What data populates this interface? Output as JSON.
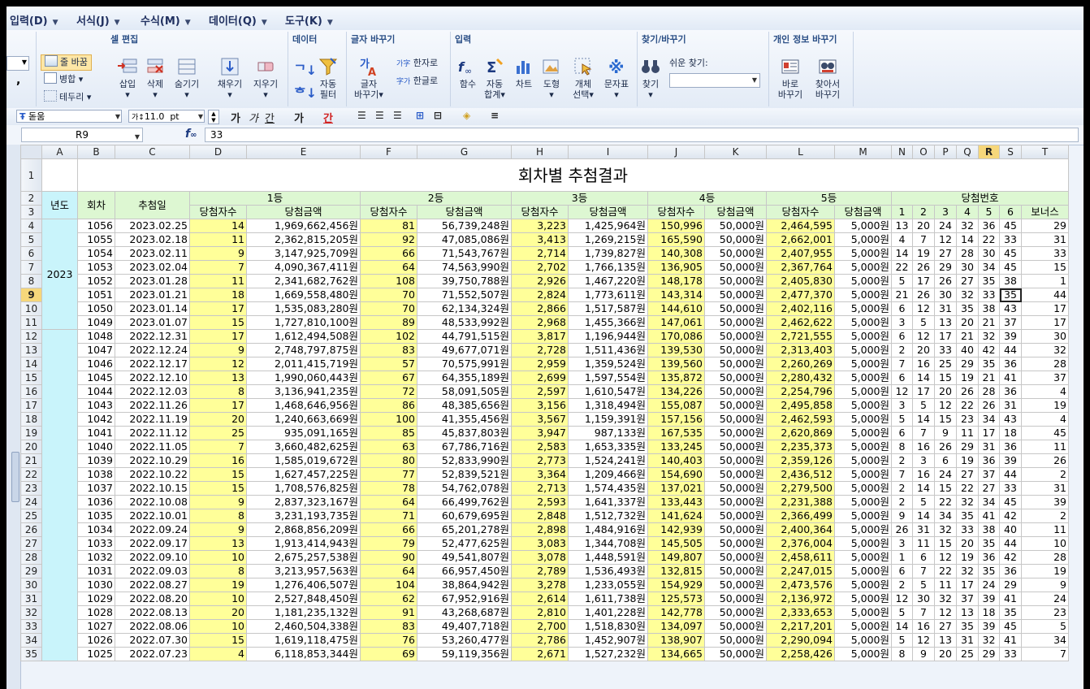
{
  "menu": [
    {
      "label": "입력(D)"
    },
    {
      "label": "서식(J)"
    },
    {
      "label": "수식(M)"
    },
    {
      "label": "데이터(Q)"
    },
    {
      "label": "도구(K)"
    }
  ],
  "ribbon": {
    "edit_title": "셀 편집",
    "wrap": "줄 바꿈",
    "merge": "병합",
    "border": "테두리",
    "insert": "삽입",
    "delete": "삭제",
    "hide": "숨기기",
    "fill": "채우기",
    "clear": "지우기",
    "data_title": "데이터",
    "auto_filter_1": "자동",
    "auto_filter_2": "필터",
    "conv_title": "글자 바꾸기",
    "conv_1": "글자",
    "conv_2": "바꾸기",
    "hanja": "한자로",
    "hangul": "한글로",
    "input_title": "입력",
    "func": "함수",
    "autosum_1": "자동",
    "autosum_2": "합계",
    "chart": "차트",
    "shape": "도형",
    "obj_1": "개체",
    "obj_2": "선택",
    "symbol": "문자표",
    "find_title": "찾기/바꾸기",
    "find": "찾기",
    "easy_find": "쉬운 찾기:",
    "privacy_title": "개인 정보 바꾸기",
    "priv1_1": "바로",
    "priv1_2": "바꾸기",
    "priv2_1": "찾아서",
    "priv2_2": "바꾸기"
  },
  "format": {
    "font": "돋움",
    "size": "11.0",
    "unit": "pt"
  },
  "formula": {
    "cell": "R9",
    "value": "33"
  },
  "columns": [
    "A",
    "B",
    "C",
    "D",
    "E",
    "F",
    "G",
    "H",
    "I",
    "J",
    "K",
    "L",
    "M",
    "N",
    "O",
    "P",
    "Q",
    "R",
    "S",
    "T"
  ],
  "selected_col": "R",
  "selected_row": "9",
  "sheet": {
    "title": "회차별 추첨결과",
    "h_year": "년도",
    "h_round": "회차",
    "h_date": "추첨일",
    "h_rank1": "1등",
    "h_rank2": "2등",
    "h_rank3": "3등",
    "h_rank4": "4등",
    "h_rank5": "5등",
    "h_nums": "당첨번호",
    "h_winners": "당첨자수",
    "h_amount": "당첨금액",
    "h_n1": "1",
    "h_n2": "2",
    "h_n3": "3",
    "h_n4": "4",
    "h_n5": "5",
    "h_n6": "6",
    "h_bonus": "보너스",
    "year_2023": "2023",
    "rows": [
      [
        "1056",
        "2023.02.25",
        "14",
        "1,969,662,456원",
        "81",
        "56,739,248원",
        "3,223",
        "1,425,964원",
        "150,996",
        "50,000원",
        "2,464,595",
        "5,000원",
        "13",
        "20",
        "24",
        "32",
        "36",
        "45",
        "29"
      ],
      [
        "1055",
        "2023.02.18",
        "11",
        "2,362,815,205원",
        "92",
        "47,085,086원",
        "3,413",
        "1,269,215원",
        "165,590",
        "50,000원",
        "2,662,001",
        "5,000원",
        "4",
        "7",
        "12",
        "14",
        "22",
        "33",
        "31"
      ],
      [
        "1054",
        "2023.02.11",
        "9",
        "3,147,925,709원",
        "66",
        "71,543,767원",
        "2,714",
        "1,739,827원",
        "140,308",
        "50,000원",
        "2,407,955",
        "5,000원",
        "14",
        "19",
        "27",
        "28",
        "30",
        "45",
        "33"
      ],
      [
        "1053",
        "2023.02.04",
        "7",
        "4,090,367,411원",
        "64",
        "74,563,990원",
        "2,702",
        "1,766,135원",
        "136,905",
        "50,000원",
        "2,367,764",
        "5,000원",
        "22",
        "26",
        "29",
        "30",
        "34",
        "45",
        "15"
      ],
      [
        "1052",
        "2023.01.28",
        "11",
        "2,341,682,762원",
        "108",
        "39,750,788원",
        "2,926",
        "1,467,220원",
        "148,178",
        "50,000원",
        "2,405,830",
        "5,000원",
        "5",
        "17",
        "26",
        "27",
        "35",
        "38",
        "1"
      ],
      [
        "1051",
        "2023.01.21",
        "18",
        "1,669,558,480원",
        "70",
        "71,552,507원",
        "2,824",
        "1,773,611원",
        "143,314",
        "50,000원",
        "2,477,370",
        "5,000원",
        "21",
        "26",
        "30",
        "32",
        "33",
        "35",
        "44"
      ],
      [
        "1050",
        "2023.01.14",
        "17",
        "1,535,083,280원",
        "70",
        "62,134,324원",
        "2,866",
        "1,517,587원",
        "144,610",
        "50,000원",
        "2,402,116",
        "5,000원",
        "6",
        "12",
        "31",
        "35",
        "38",
        "43",
        "17"
      ],
      [
        "1049",
        "2023.01.07",
        "15",
        "1,727,810,100원",
        "89",
        "48,533,992원",
        "2,968",
        "1,455,366원",
        "147,061",
        "50,000원",
        "2,462,622",
        "5,000원",
        "3",
        "5",
        "13",
        "20",
        "21",
        "37",
        "17"
      ],
      [
        "1048",
        "2022.12.31",
        "17",
        "1,612,494,508원",
        "102",
        "44,791,515원",
        "3,817",
        "1,196,944원",
        "170,086",
        "50,000원",
        "2,721,555",
        "5,000원",
        "6",
        "12",
        "17",
        "21",
        "32",
        "39",
        "30"
      ],
      [
        "1047",
        "2022.12.24",
        "9",
        "2,748,797,875원",
        "83",
        "49,677,071원",
        "2,728",
        "1,511,436원",
        "139,530",
        "50,000원",
        "2,313,403",
        "5,000원",
        "2",
        "20",
        "33",
        "40",
        "42",
        "44",
        "32"
      ],
      [
        "1046",
        "2022.12.17",
        "12",
        "2,011,415,719원",
        "57",
        "70,575,991원",
        "2,959",
        "1,359,524원",
        "139,560",
        "50,000원",
        "2,260,269",
        "5,000원",
        "7",
        "16",
        "25",
        "29",
        "35",
        "36",
        "28"
      ],
      [
        "1045",
        "2022.12.10",
        "13",
        "1,990,060,443원",
        "67",
        "64,355,189원",
        "2,699",
        "1,597,554원",
        "135,872",
        "50,000원",
        "2,280,432",
        "5,000원",
        "6",
        "14",
        "15",
        "19",
        "21",
        "41",
        "37"
      ],
      [
        "1044",
        "2022.12.03",
        "8",
        "3,136,941,235원",
        "72",
        "58,091,505원",
        "2,597",
        "1,610,547원",
        "134,226",
        "50,000원",
        "2,254,796",
        "5,000원",
        "12",
        "17",
        "20",
        "26",
        "28",
        "36",
        "4"
      ],
      [
        "1043",
        "2022.11.26",
        "17",
        "1,468,646,956원",
        "86",
        "48,385,656원",
        "3,156",
        "1,318,494원",
        "155,087",
        "50,000원",
        "2,495,858",
        "5,000원",
        "3",
        "5",
        "12",
        "22",
        "26",
        "31",
        "19"
      ],
      [
        "1042",
        "2022.11.19",
        "20",
        "1,240,663,669원",
        "100",
        "41,355,456원",
        "3,567",
        "1,159,391원",
        "157,156",
        "50,000원",
        "2,462,593",
        "5,000원",
        "5",
        "14",
        "15",
        "23",
        "34",
        "43",
        "4"
      ],
      [
        "1041",
        "2022.11.12",
        "25",
        "935,091,165원",
        "85",
        "45,837,803원",
        "3,947",
        "987,133원",
        "167,535",
        "50,000원",
        "2,620,869",
        "5,000원",
        "6",
        "7",
        "9",
        "11",
        "17",
        "18",
        "45"
      ],
      [
        "1040",
        "2022.11.05",
        "7",
        "3,660,482,625원",
        "63",
        "67,786,716원",
        "2,583",
        "1,653,335원",
        "133,245",
        "50,000원",
        "2,235,373",
        "5,000원",
        "8",
        "16",
        "26",
        "29",
        "31",
        "36",
        "11"
      ],
      [
        "1039",
        "2022.10.29",
        "16",
        "1,585,019,672원",
        "80",
        "52,833,990원",
        "2,773",
        "1,524,241원",
        "140,403",
        "50,000원",
        "2,359,126",
        "5,000원",
        "2",
        "3",
        "6",
        "19",
        "36",
        "39",
        "26"
      ],
      [
        "1038",
        "2022.10.22",
        "15",
        "1,627,457,225원",
        "77",
        "52,839,521원",
        "3,364",
        "1,209,466원",
        "154,690",
        "50,000원",
        "2,436,512",
        "5,000원",
        "7",
        "16",
        "24",
        "27",
        "37",
        "44",
        "2"
      ],
      [
        "1037",
        "2022.10.15",
        "15",
        "1,708,576,825원",
        "78",
        "54,762,078원",
        "2,713",
        "1,574,435원",
        "137,021",
        "50,000원",
        "2,279,500",
        "5,000원",
        "2",
        "14",
        "15",
        "22",
        "27",
        "33",
        "31"
      ],
      [
        "1036",
        "2022.10.08",
        "9",
        "2,837,323,167원",
        "64",
        "66,499,762원",
        "2,593",
        "1,641,337원",
        "133,443",
        "50,000원",
        "2,231,388",
        "5,000원",
        "2",
        "5",
        "22",
        "32",
        "34",
        "45",
        "39"
      ],
      [
        "1035",
        "2022.10.01",
        "8",
        "3,231,193,735원",
        "71",
        "60,679,695원",
        "2,848",
        "1,512,732원",
        "141,624",
        "50,000원",
        "2,366,499",
        "5,000원",
        "9",
        "14",
        "34",
        "35",
        "41",
        "42",
        "2"
      ],
      [
        "1034",
        "2022.09.24",
        "9",
        "2,868,856,209원",
        "66",
        "65,201,278원",
        "2,898",
        "1,484,916원",
        "142,939",
        "50,000원",
        "2,400,364",
        "5,000원",
        "26",
        "31",
        "32",
        "33",
        "38",
        "40",
        "11"
      ],
      [
        "1033",
        "2022.09.17",
        "13",
        "1,913,414,943원",
        "79",
        "52,477,625원",
        "3,083",
        "1,344,708원",
        "145,505",
        "50,000원",
        "2,376,004",
        "5,000원",
        "3",
        "11",
        "15",
        "20",
        "35",
        "44",
        "10"
      ],
      [
        "1032",
        "2022.09.10",
        "10",
        "2,675,257,538원",
        "90",
        "49,541,807원",
        "3,078",
        "1,448,591원",
        "149,807",
        "50,000원",
        "2,458,611",
        "5,000원",
        "1",
        "6",
        "12",
        "19",
        "36",
        "42",
        "28"
      ],
      [
        "1031",
        "2022.09.03",
        "8",
        "3,213,957,563원",
        "64",
        "66,957,450원",
        "2,789",
        "1,536,493원",
        "132,815",
        "50,000원",
        "2,247,015",
        "5,000원",
        "6",
        "7",
        "22",
        "32",
        "35",
        "36",
        "19"
      ],
      [
        "1030",
        "2022.08.27",
        "19",
        "1,276,406,507원",
        "104",
        "38,864,942원",
        "3,278",
        "1,233,055원",
        "154,929",
        "50,000원",
        "2,473,576",
        "5,000원",
        "2",
        "5",
        "11",
        "17",
        "24",
        "29",
        "9"
      ],
      [
        "1029",
        "2022.08.20",
        "10",
        "2,527,848,450원",
        "62",
        "67,952,916원",
        "2,614",
        "1,611,738원",
        "125,573",
        "50,000원",
        "2,136,972",
        "5,000원",
        "12",
        "30",
        "32",
        "37",
        "39",
        "41",
        "24"
      ],
      [
        "1028",
        "2022.08.13",
        "20",
        "1,181,235,132원",
        "91",
        "43,268,687원",
        "2,810",
        "1,401,228원",
        "142,778",
        "50,000원",
        "2,333,653",
        "5,000원",
        "5",
        "7",
        "12",
        "13",
        "18",
        "35",
        "23"
      ],
      [
        "1027",
        "2022.08.06",
        "10",
        "2,460,504,338원",
        "83",
        "49,407,718원",
        "2,700",
        "1,518,830원",
        "134,097",
        "50,000원",
        "2,217,201",
        "5,000원",
        "14",
        "16",
        "27",
        "35",
        "39",
        "45",
        "5"
      ],
      [
        "1026",
        "2022.07.30",
        "15",
        "1,619,118,475원",
        "76",
        "53,260,477원",
        "2,786",
        "1,452,907원",
        "138,907",
        "50,000원",
        "2,290,094",
        "5,000원",
        "5",
        "12",
        "13",
        "31",
        "32",
        "41",
        "34"
      ],
      [
        "1025",
        "2022.07.23",
        "4",
        "6,118,853,344원",
        "69",
        "59,119,356원",
        "2,671",
        "1,527,232원",
        "134,665",
        "50,000원",
        "2,258,426",
        "5,000원",
        "8",
        "9",
        "20",
        "25",
        "29",
        "33",
        "7"
      ]
    ]
  }
}
